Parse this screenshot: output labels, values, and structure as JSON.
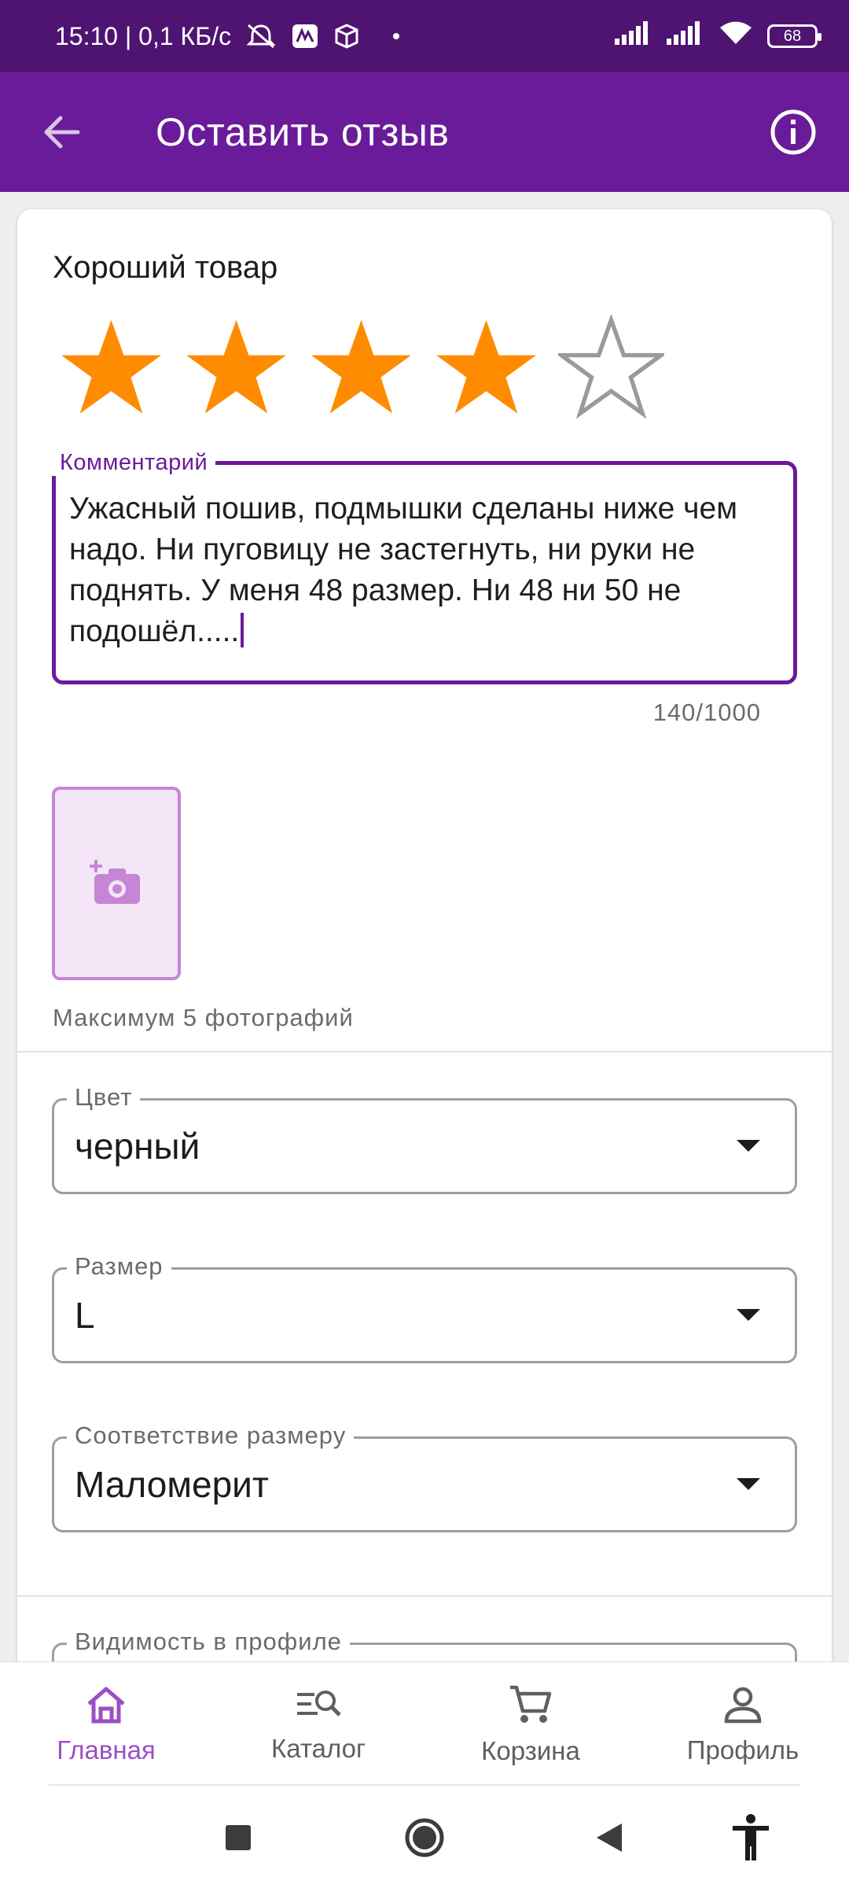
{
  "status_bar": {
    "time_speed": "15:10 | 0,1 КБ/с",
    "battery": "68"
  },
  "app_bar": {
    "title": "Оставить отзыв"
  },
  "review": {
    "product_name": "Хороший товар",
    "rating": 4,
    "rating_max": 5,
    "comment_label": "Комментарий",
    "comment_text": " Ужасный пошив, подмышки сделаны ниже чем надо. Ни пуговицу не застегнуть, ни руки не поднять. У меня 48 размер. Ни 48 ни 50 не подошёл.....",
    "counter": "140/1000",
    "photo_hint": "Максимум 5 фотографий"
  },
  "fields": {
    "color": {
      "label": "Цвет",
      "value": "черный"
    },
    "size": {
      "label": "Размер",
      "value": "L"
    },
    "fit": {
      "label": "Соответствие размеру",
      "value": "Маломерит"
    },
    "visibility": {
      "label": "Видимость в профиле",
      "value": ""
    }
  },
  "bottom_nav": {
    "home": "Главная",
    "catalog": "Каталог",
    "cart": "Корзина",
    "profile": "Профиль"
  },
  "colors": {
    "status_bar": "#4f1472",
    "app_bar": "#6a1b9a",
    "star": "#ff8c00",
    "active_nav": "#9c4fc4"
  }
}
